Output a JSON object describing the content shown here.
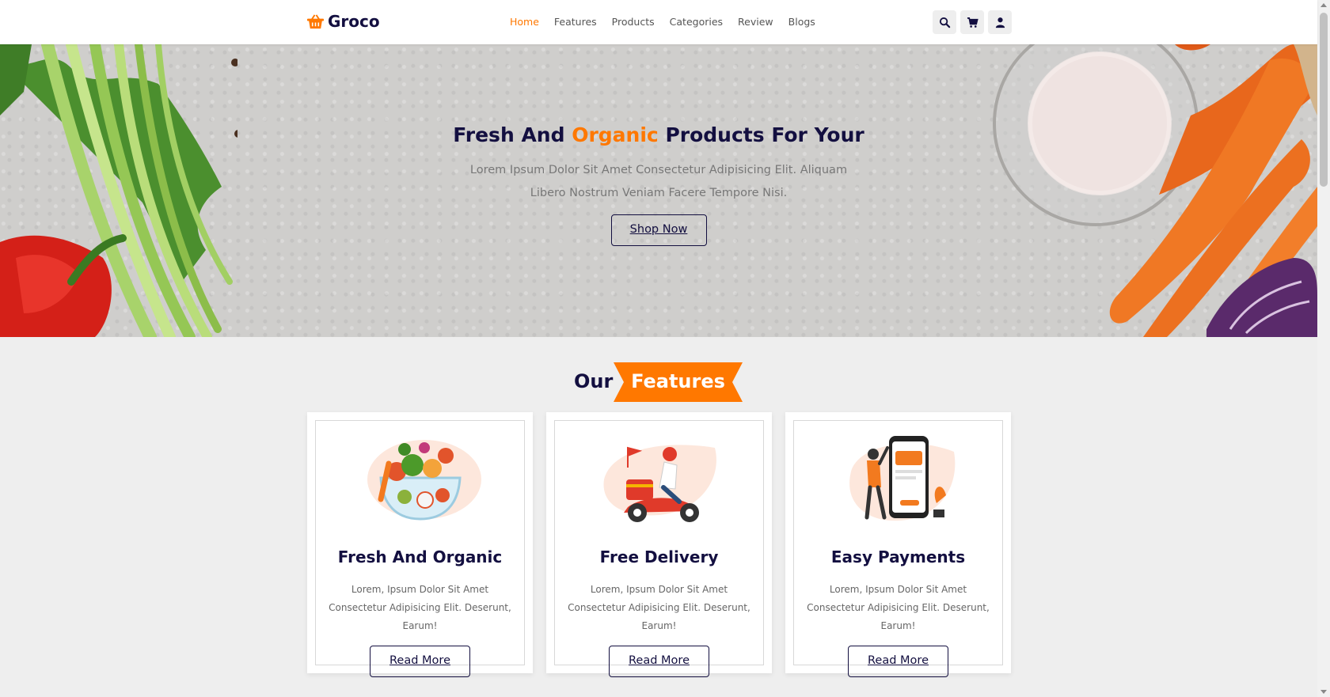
{
  "brand": {
    "name": "Groco",
    "accent": "#ff7800",
    "dark": "#130f40"
  },
  "nav": {
    "items": [
      {
        "label": "Home",
        "active": true
      },
      {
        "label": "Features",
        "active": false
      },
      {
        "label": "Products",
        "active": false
      },
      {
        "label": "Categories",
        "active": false
      },
      {
        "label": "Review",
        "active": false
      },
      {
        "label": "Blogs",
        "active": false
      }
    ]
  },
  "header_icons": [
    "search-icon",
    "cart-icon",
    "user-icon"
  ],
  "hero": {
    "title_part1": "Fresh And ",
    "title_highlight": "Organic",
    "title_part2": " Products For Your",
    "description": "Lorem Ipsum Dolor Sit Amet Consectetur Adipisicing Elit. Aliquam Libero Nostrum Veniam Facere Tempore Nisi.",
    "button_label": "Shop Now"
  },
  "features": {
    "heading_plain": "Our",
    "heading_tag": "Features",
    "cards": [
      {
        "title": "Fresh And Organic",
        "description": "Lorem, Ipsum Dolor Sit Amet Consectetur Adipisicing Elit. Deserunt, Earum!",
        "button_label": "Read More",
        "image": "vegetable-bowl-illustration"
      },
      {
        "title": "Free Delivery",
        "description": "Lorem, Ipsum Dolor Sit Amet Consectetur Adipisicing Elit. Deserunt, Earum!",
        "button_label": "Read More",
        "image": "delivery-scooter-illustration"
      },
      {
        "title": "Easy Payments",
        "description": "Lorem, Ipsum Dolor Sit Amet Consectetur Adipisicing Elit. Deserunt, Earum!",
        "button_label": "Read More",
        "image": "mobile-payment-illustration"
      }
    ]
  }
}
